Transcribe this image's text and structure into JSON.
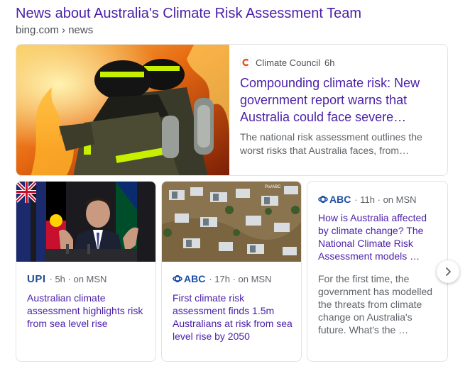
{
  "header": {
    "title": "News about Australia's Climate Risk Assessment Team",
    "breadcrumb": "bing.com › news"
  },
  "featured": {
    "source": "Climate Council",
    "age": "6h",
    "title": "Compounding climate risk: New government report warns that Australia could face severe…",
    "snippet": "The national risk assessment outlines the worst risks that Australia faces, from…",
    "image_alt": "firefighters in front of flames"
  },
  "articles": [
    {
      "source": "UPI",
      "meta": "· 5h · on MSN",
      "title": "Australian climate assessment highlights risk from sea level rise"
    },
    {
      "source": "ABC",
      "meta": "· 17h · on MSN",
      "title": "First climate risk assessment finds 1.5m Australians at risk from sea level rise by 2050"
    },
    {
      "source": "ABC",
      "meta": "· 11h · on MSN",
      "title": "How is Australia affected by climate change? The National Climate Risk Assessment models …",
      "snippet": "For the first time, the government has modelled the threats from climate change on Australia's future. What's the …"
    }
  ],
  "colors": {
    "link": "#4a1fa8",
    "abc_blue": "#1d4fa5",
    "upi_blue": "#1f4f8f"
  },
  "icons": {
    "next": "chevron-right-icon",
    "climate_council": "climate-council-logo-icon",
    "abc": "abc-logo-icon"
  }
}
